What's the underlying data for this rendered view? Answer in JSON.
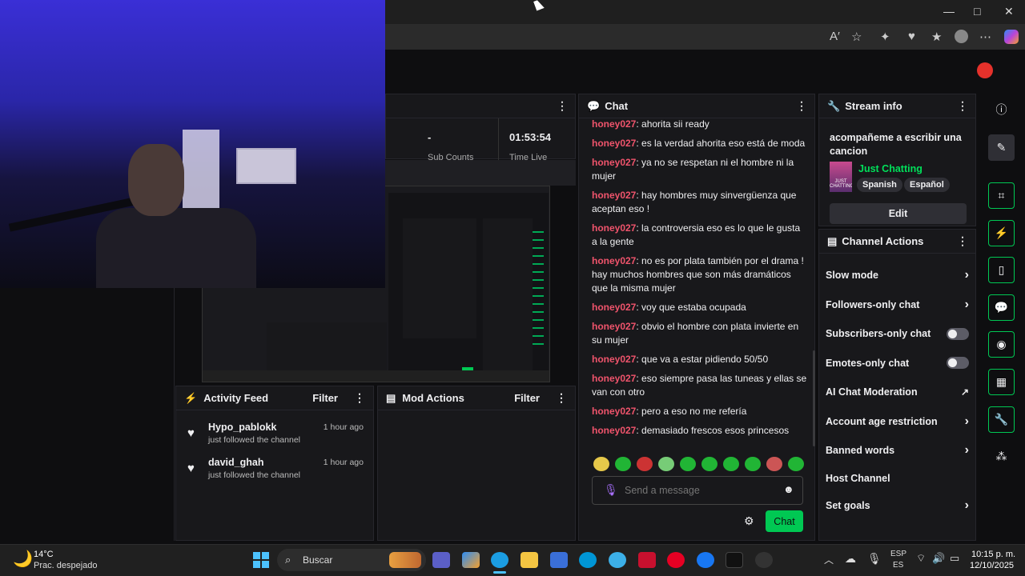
{
  "window": {
    "minimize": "—",
    "maximize": "□",
    "close": "✕"
  },
  "browser": {
    "icons": [
      "read-aloud-icon",
      "favorite-icon",
      "extensions-icon",
      "performance-icon",
      "favorites-icon",
      "profile-icon",
      "more-icon",
      "copilot-icon"
    ]
  },
  "stats": {
    "value_left": "-",
    "value_right": "01:53:54",
    "label_left": "Sub Counts",
    "label_right": "Time Live"
  },
  "chat": {
    "title": "Chat",
    "messages": [
      {
        "user": "honey027",
        "text": "ahorita sii ready"
      },
      {
        "user": "honey027",
        "text": "es la verdad ahorita eso está de moda"
      },
      {
        "user": "honey027",
        "text": "ya no se respetan ni el hombre ni la mujer"
      },
      {
        "user": "honey027",
        "text": "hay hombres muy sinvergüenza que aceptan eso !"
      },
      {
        "user": "honey027",
        "text": "la controversia eso es lo que le gusta a la gente"
      },
      {
        "user": "honey027",
        "text": "no es por plata también por el drama ! hay muchos hombres que son más dramáticos que la misma mujer"
      },
      {
        "user": "honey027",
        "text": "voy que estaba ocupada"
      },
      {
        "user": "honey027",
        "text": "obvio el hombre con plata invierte en su mujer"
      },
      {
        "user": "honey027",
        "text": "que va a estar pidiendo 50/50"
      },
      {
        "user": "honey027",
        "text": "eso siempre pasa las tuneas y ellas se van con otro"
      },
      {
        "user": "honey027",
        "text": "pero a eso no me refería"
      },
      {
        "user": "honey027",
        "text": "demasiado frescos esos princesos"
      }
    ],
    "input_placeholder": "Send a message",
    "send_label": "Chat"
  },
  "stream_info": {
    "title": "Stream info",
    "stream_title": "acompañeme a escribir una cancion",
    "category": "Just Chatting",
    "tags": [
      "Spanish",
      "Español"
    ],
    "edit_label": "Edit",
    "thumb_text": "JUST CHATTING"
  },
  "channel_actions": {
    "title": "Channel Actions",
    "items": [
      {
        "label": "Slow mode",
        "control": "chevron"
      },
      {
        "label": "Followers-only chat",
        "control": "chevron"
      },
      {
        "label": "Subscribers-only chat",
        "control": "toggle"
      },
      {
        "label": "Emotes-only chat",
        "control": "toggle"
      },
      {
        "label": "AI Chat Moderation",
        "control": "external"
      },
      {
        "label": "Account age restriction",
        "control": "chevron"
      },
      {
        "label": "Banned words",
        "control": "chevron"
      },
      {
        "label": "Host Channel",
        "control": "none"
      },
      {
        "label": "Set goals",
        "control": "chevron"
      }
    ]
  },
  "activity_feed": {
    "title": "Activity Feed",
    "filter_label": "Filter",
    "items": [
      {
        "user": "Hypo_pablokk",
        "action": "just followed the channel",
        "time": "1 hour ago"
      },
      {
        "user": "david_ghah",
        "action": "just followed the channel",
        "time": "1 hour ago"
      }
    ]
  },
  "mod_actions": {
    "title": "Mod Actions",
    "filter_label": "Filter"
  },
  "taskbar": {
    "weather_temp": "14°C",
    "weather_desc": "Prac. despejado",
    "search_label": "Buscar",
    "lang_top": "ESP",
    "lang_bottom": "ES",
    "time": "10:15 p. m.",
    "date": "12/10/2025"
  },
  "colors": {
    "accent": "#00c853",
    "username": "#f0546c",
    "category": "#00e05a",
    "panel": "#18181b"
  }
}
